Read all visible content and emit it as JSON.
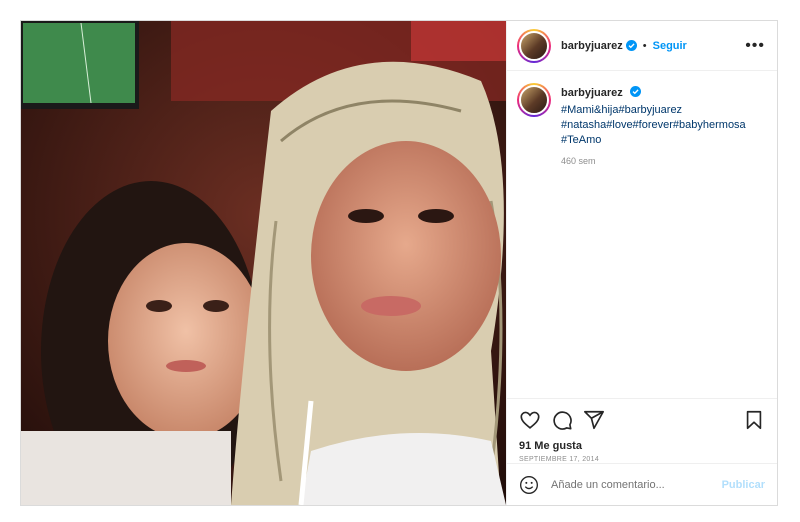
{
  "post": {
    "username": "barbyjuarez",
    "follow_label": "Seguir",
    "separator": "•",
    "more_label": "•••",
    "caption": {
      "username": "barbyjuarez",
      "hashtags": [
        "#Mami&hija#barbyjuarez",
        "#natasha#love#forever#babyhermosa",
        "#TeAmo"
      ],
      "time_ago": "460 sem"
    },
    "likes": "91 Me gusta",
    "date": "SEPTIEMBRE 17, 2014",
    "comment": {
      "placeholder": "Añade un comentario...",
      "publish_label": "Publicar"
    }
  },
  "colors": {
    "link_blue": "#0095f6",
    "hashtag": "#00376b",
    "publish_disabled": "#b2dffc",
    "muted": "#8e8e8e"
  },
  "icons": [
    "verified-badge-icon",
    "more-options-icon",
    "heart-icon",
    "comment-icon",
    "share-icon",
    "bookmark-icon",
    "emoji-icon"
  ]
}
